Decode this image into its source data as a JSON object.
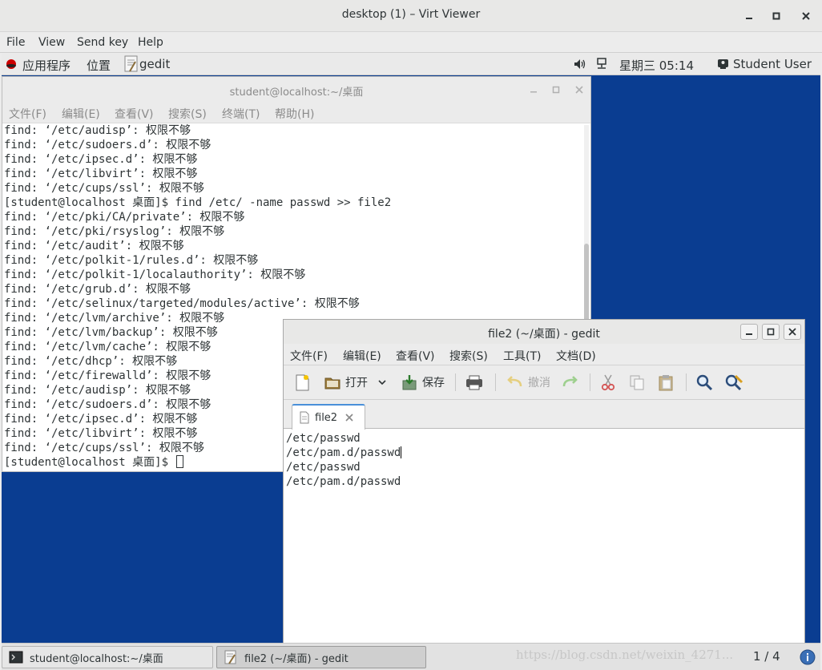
{
  "viewer": {
    "title": "desktop (1) – Virt Viewer",
    "menu": [
      "File",
      "View",
      "Send key",
      "Help"
    ]
  },
  "panel": {
    "applications": "应用程序",
    "places": "位置",
    "running_app": "gedit",
    "clock": "星期三 05:14",
    "user": "Student User"
  },
  "terminal": {
    "title": "student@localhost:~/桌面",
    "menu": [
      "文件(F)",
      "编辑(E)",
      "查看(V)",
      "搜索(S)",
      "终端(T)",
      "帮助(H)"
    ],
    "lines": [
      "find: ‘/etc/audisp’: 权限不够",
      "find: ‘/etc/sudoers.d’: 权限不够",
      "find: ‘/etc/ipsec.d’: 权限不够",
      "find: ‘/etc/libvirt’: 权限不够",
      "find: ‘/etc/cups/ssl’: 权限不够",
      "[student@localhost 桌面]$ find /etc/ -name passwd >> file2",
      "find: ‘/etc/pki/CA/private’: 权限不够",
      "find: ‘/etc/pki/rsyslog’: 权限不够",
      "find: ‘/etc/audit’: 权限不够",
      "find: ‘/etc/polkit-1/rules.d’: 权限不够",
      "find: ‘/etc/polkit-1/localauthority’: 权限不够",
      "find: ‘/etc/grub.d’: 权限不够",
      "find: ‘/etc/selinux/targeted/modules/active’: 权限不够",
      "find: ‘/etc/lvm/archive’: 权限不够",
      "find: ‘/etc/lvm/backup’: 权限不够",
      "find: ‘/etc/lvm/cache’: 权限不够",
      "find: ‘/etc/dhcp’: 权限不够",
      "find: ‘/etc/firewalld’: 权限不够",
      "find: ‘/etc/audisp’: 权限不够",
      "find: ‘/etc/sudoers.d’: 权限不够",
      "find: ‘/etc/ipsec.d’: 权限不够",
      "find: ‘/etc/libvirt’: 权限不够",
      "find: ‘/etc/cups/ssl’: 权限不够"
    ],
    "prompt": "[student@localhost 桌面]$ "
  },
  "gedit": {
    "title": "file2 (~/桌面) - gedit",
    "menu": [
      "文件(F)",
      "编辑(E)",
      "查看(V)",
      "搜索(S)",
      "工具(T)",
      "文档(D)"
    ],
    "toolbar": {
      "open": "打开",
      "save": "保存",
      "undo": "撤消"
    },
    "tab": "file2",
    "lines": [
      "/etc/passwd",
      "/etc/pam.d/passwd",
      "/etc/passwd",
      "/etc/pam.d/passwd"
    ]
  },
  "taskbar": {
    "items": [
      "student@localhost:~/桌面",
      "file2 (~/桌面) - gedit"
    ],
    "watermark": "https://blog.csdn.net/weixin_4271...",
    "pager": "1 / 4"
  },
  "colors": {
    "desktop": "#0a3d91",
    "tab_accent": "#4a90d9",
    "redhat": "#cc0000"
  }
}
